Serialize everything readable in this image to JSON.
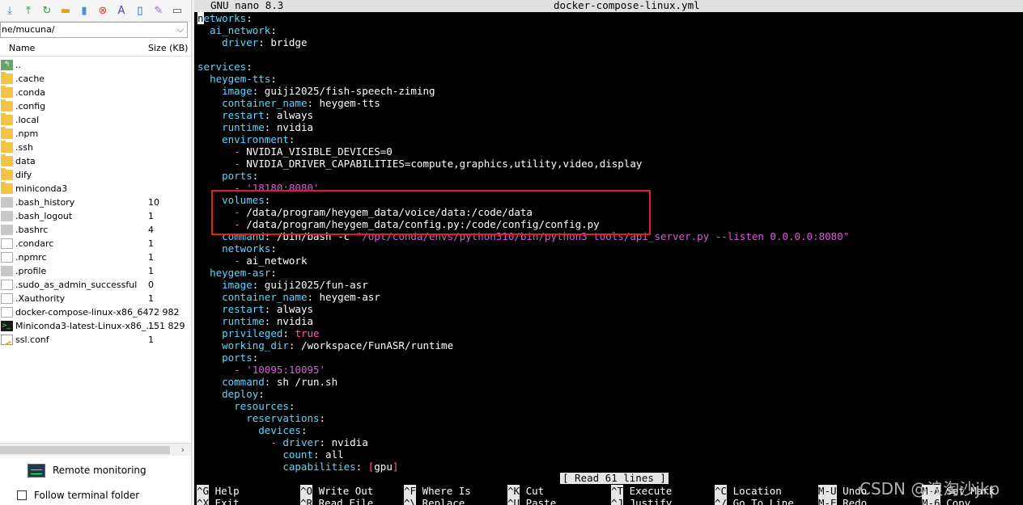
{
  "file_panel": {
    "path": "ne/mucuna/",
    "columns": {
      "name": "Name",
      "size": "Size (KB)"
    },
    "files": [
      {
        "name": "..",
        "size": "",
        "icon": "parent-folder-icon"
      },
      {
        "name": ".cache",
        "size": "",
        "icon": "folder-icon"
      },
      {
        "name": ".conda",
        "size": "",
        "icon": "folder-icon"
      },
      {
        "name": ".config",
        "size": "",
        "icon": "folder-icon"
      },
      {
        "name": ".local",
        "size": "",
        "icon": "folder-icon"
      },
      {
        "name": ".npm",
        "size": "",
        "icon": "folder-icon"
      },
      {
        "name": ".ssh",
        "size": "",
        "icon": "folder-icon"
      },
      {
        "name": "data",
        "size": "",
        "icon": "folder-icon"
      },
      {
        "name": "dify",
        "size": "",
        "icon": "folder-icon"
      },
      {
        "name": "miniconda3",
        "size": "",
        "icon": "folder-icon"
      },
      {
        "name": ".bash_history",
        "size": "10",
        "icon": "hidden-file-icon"
      },
      {
        "name": ".bash_logout",
        "size": "1",
        "icon": "hidden-file-icon"
      },
      {
        "name": ".bashrc",
        "size": "4",
        "icon": "hidden-file-icon"
      },
      {
        "name": ".condarc",
        "size": "1",
        "icon": "file-icon"
      },
      {
        "name": ".npmrc",
        "size": "1",
        "icon": "file-icon"
      },
      {
        "name": ".profile",
        "size": "1",
        "icon": "hidden-file-icon"
      },
      {
        "name": ".sudo_as_admin_successful",
        "size": "0",
        "icon": "file-icon"
      },
      {
        "name": ".Xauthority",
        "size": "1",
        "icon": "file-icon"
      },
      {
        "name": "docker-compose-linux-x86_64",
        "size": "72 982",
        "icon": "file-icon"
      },
      {
        "name": "Miniconda3-latest-Linux-x86_...",
        "size": "151 829",
        "icon": "terminal-file-icon"
      },
      {
        "name": "ssl.conf",
        "size": "1",
        "icon": "config-file-icon"
      }
    ],
    "remote_monitoring": "Remote monitoring",
    "follow_terminal_folder": "Follow terminal folder"
  },
  "nano": {
    "title_left": "GNU nano 8.3",
    "title_center": "docker-compose-linux.yml",
    "status_message": "[ Read 61 lines ]",
    "help_row1": [
      {
        "key": "^G",
        "label": "Help"
      },
      {
        "key": "^O",
        "label": "Write Out"
      },
      {
        "key": "^F",
        "label": "Where Is"
      },
      {
        "key": "^K",
        "label": "Cut"
      },
      {
        "key": "^T",
        "label": "Execute"
      },
      {
        "key": "^C",
        "label": "Location"
      },
      {
        "key": "M-U",
        "label": "Undo"
      },
      {
        "key": "M-A",
        "label": "Set Mark"
      }
    ],
    "help_row2": [
      {
        "key": "^X",
        "label": "Exit"
      },
      {
        "key": "^R",
        "label": "Read File"
      },
      {
        "key": "^\\",
        "label": "Replace"
      },
      {
        "key": "^U",
        "label": "Paste"
      },
      {
        "key": "^J",
        "label": "Justify"
      },
      {
        "key": "^/",
        "label": "Go To Line"
      },
      {
        "key": "M-E",
        "label": "Redo"
      },
      {
        "key": "M-6",
        "label": "Copy"
      }
    ]
  },
  "code_lines": [
    [
      [
        "k",
        "networks"
      ],
      [
        "",
        ""
      ],
      [
        "w",
        ":"
      ]
    ],
    [
      [
        "w",
        "  "
      ],
      [
        "k",
        "ai_network"
      ],
      [
        "w",
        ":"
      ]
    ],
    [
      [
        "w",
        "    "
      ],
      [
        "k",
        "driver"
      ],
      [
        "w",
        ": bridge"
      ]
    ],
    [],
    [
      [
        "k",
        "services"
      ],
      [
        "w",
        ":"
      ]
    ],
    [
      [
        "w",
        "  "
      ],
      [
        "k",
        "heygem-tts"
      ],
      [
        "w",
        ":"
      ]
    ],
    [
      [
        "w",
        "    "
      ],
      [
        "k",
        "image"
      ],
      [
        "w",
        ": guiji2025/fish-speech-ziming"
      ]
    ],
    [
      [
        "w",
        "    "
      ],
      [
        "k",
        "container_name"
      ],
      [
        "w",
        ": heygem-tts"
      ]
    ],
    [
      [
        "w",
        "    "
      ],
      [
        "k",
        "restart"
      ],
      [
        "w",
        ": always"
      ]
    ],
    [
      [
        "w",
        "    "
      ],
      [
        "k",
        "runtime"
      ],
      [
        "w",
        ": nvidia"
      ]
    ],
    [
      [
        "w",
        "    "
      ],
      [
        "k",
        "environment"
      ],
      [
        "w",
        ":"
      ]
    ],
    [
      [
        "w",
        "      "
      ],
      [
        "b",
        "- "
      ],
      [
        "w",
        "NVIDIA_VISIBLE_DEVICES=0"
      ]
    ],
    [
      [
        "w",
        "      "
      ],
      [
        "b",
        "- "
      ],
      [
        "w",
        "NVIDIA_DRIVER_CAPABILITIES=compute,graphics,utility,video,display"
      ]
    ],
    [
      [
        "w",
        "    "
      ],
      [
        "k",
        "ports"
      ],
      [
        "w",
        ":"
      ]
    ],
    [
      [
        "w",
        "      "
      ],
      [
        "b",
        "- "
      ],
      [
        "s",
        "'18180:8080'"
      ]
    ],
    [
      [
        "w",
        "    "
      ],
      [
        "k",
        "volumes"
      ],
      [
        "w",
        ":"
      ]
    ],
    [
      [
        "w",
        "      "
      ],
      [
        "b",
        "- "
      ],
      [
        "w",
        "/data/program/heygem_data/voice/data:/code/data"
      ]
    ],
    [
      [
        "w",
        "      "
      ],
      [
        "b",
        "- "
      ],
      [
        "w",
        "/data/program/heygem_data/config.py:/code/config/config.py"
      ]
    ],
    [
      [
        "w",
        "    "
      ],
      [
        "k",
        "command"
      ],
      [
        "w",
        ": /bin/bash -c "
      ],
      [
        "s",
        "\"/opt/conda/envs/python310/bin/python3 tools/api_server.py --listen 0.0.0.0:8080\""
      ]
    ],
    [
      [
        "w",
        "    "
      ],
      [
        "k",
        "networks"
      ],
      [
        "w",
        ":"
      ]
    ],
    [
      [
        "w",
        "      "
      ],
      [
        "b",
        "- "
      ],
      [
        "w",
        "ai_network"
      ]
    ],
    [
      [
        "w",
        "  "
      ],
      [
        "k",
        "heygem-asr"
      ],
      [
        "w",
        ":"
      ]
    ],
    [
      [
        "w",
        "    "
      ],
      [
        "k",
        "image"
      ],
      [
        "w",
        ": guiji2025/fun-asr"
      ]
    ],
    [
      [
        "w",
        "    "
      ],
      [
        "k",
        "container_name"
      ],
      [
        "w",
        ": heygem-asr"
      ]
    ],
    [
      [
        "w",
        "    "
      ],
      [
        "k",
        "restart"
      ],
      [
        "w",
        ": always"
      ]
    ],
    [
      [
        "w",
        "    "
      ],
      [
        "k",
        "runtime"
      ],
      [
        "w",
        ": nvidia"
      ]
    ],
    [
      [
        "w",
        "    "
      ],
      [
        "k",
        "privileged"
      ],
      [
        "w",
        ": "
      ],
      [
        "b",
        "true"
      ]
    ],
    [
      [
        "w",
        "    "
      ],
      [
        "k",
        "working_dir"
      ],
      [
        "w",
        ": /workspace/FunASR/runtime"
      ]
    ],
    [
      [
        "w",
        "    "
      ],
      [
        "k",
        "ports"
      ],
      [
        "w",
        ":"
      ]
    ],
    [
      [
        "w",
        "      "
      ],
      [
        "b",
        "- "
      ],
      [
        "s",
        "'10095:10095'"
      ]
    ],
    [
      [
        "w",
        "    "
      ],
      [
        "k",
        "command"
      ],
      [
        "w",
        ": sh /run.sh"
      ]
    ],
    [
      [
        "w",
        "    "
      ],
      [
        "k",
        "deploy"
      ],
      [
        "w",
        ":"
      ]
    ],
    [
      [
        "w",
        "      "
      ],
      [
        "k",
        "resources"
      ],
      [
        "w",
        ":"
      ]
    ],
    [
      [
        "w",
        "        "
      ],
      [
        "k",
        "reservations"
      ],
      [
        "w",
        ":"
      ]
    ],
    [
      [
        "w",
        "          "
      ],
      [
        "k",
        "devices"
      ],
      [
        "w",
        ":"
      ]
    ],
    [
      [
        "w",
        "            "
      ],
      [
        "b",
        "- "
      ],
      [
        "k",
        "driver"
      ],
      [
        "w",
        ": nvidia"
      ]
    ],
    [
      [
        "w",
        "              "
      ],
      [
        "k",
        "count"
      ],
      [
        "w",
        ": all"
      ]
    ],
    [
      [
        "w",
        "              "
      ],
      [
        "k",
        "capabilities"
      ],
      [
        "w",
        ": "
      ],
      [
        "b",
        "["
      ],
      [
        "w",
        "gpu"
      ],
      [
        "b",
        "]"
      ]
    ]
  ],
  "watermark": "CSDN @浪淘沙jkp",
  "colors": {
    "key": "#5fd7ff",
    "string": "#d75fd7",
    "bracket": "#ff5faf",
    "highlight_box": "#e02020"
  }
}
